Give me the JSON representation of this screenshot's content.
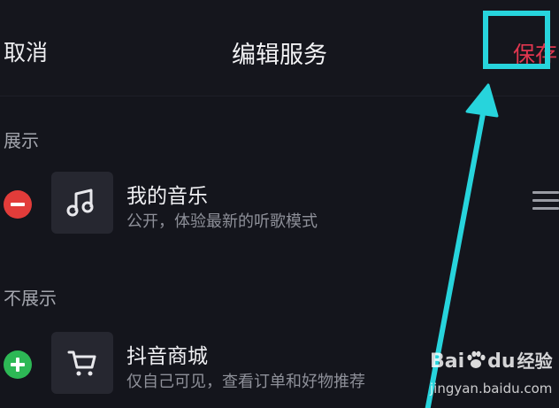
{
  "header": {
    "cancel_label": "取消",
    "title": "编辑服务",
    "save_label": "保存"
  },
  "sections": {
    "shown_label": "展示",
    "hidden_label": "不展示"
  },
  "items": [
    {
      "title": "我的音乐",
      "subtitle": "公开，体验最新的听歌模式",
      "icon": "music-note-icon",
      "action": "remove"
    },
    {
      "title": "抖音商城",
      "subtitle": "仅自己可见，查看订单和好物推荐",
      "icon": "shopping-cart-icon",
      "action": "add"
    }
  ],
  "watermark": {
    "brand": "Bai",
    "brand_suffix": "du",
    "brand_cn": "经验",
    "url": "jingyan.baidu.com"
  },
  "colors": {
    "background": "#14151c",
    "save_accent": "#e0364f",
    "remove_button": "#e23c3a",
    "add_button": "#2db855",
    "annotation": "#27d4dc"
  }
}
